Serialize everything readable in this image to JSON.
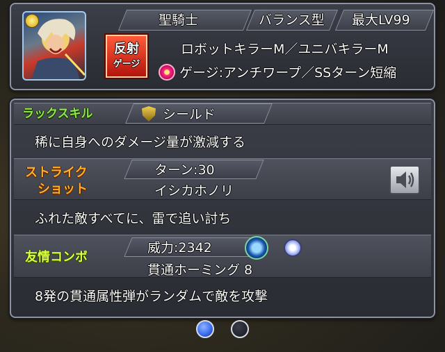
{
  "header": {
    "tribe": "聖騎士",
    "type": "バランス型",
    "max_level": "最大LV99",
    "killer": "ロボットキラーM／ユニバキラーM",
    "gauge": "ゲージ:アンチワープ／SSターン短縮",
    "badge_line1": "反射",
    "badge_line2": "ゲージ"
  },
  "luck_skill": {
    "label": "ラックスキル",
    "name": "シールド",
    "description": "稀に自身へのダメージ量が激減する"
  },
  "strike_shot": {
    "label_line1": "ストライク",
    "label_line2": "ショット",
    "turns": "ターン:30",
    "name": "イシカホノリ",
    "description": "ふれた敵すべてに、雷で追い討ち"
  },
  "friend_combo": {
    "label": "友情コンボ",
    "power": "威力:2342",
    "name": "貫通ホーミング 8",
    "description": "8発の貫通属性弾がランダムで敵を攻撃"
  },
  "pagination": {
    "pages": 2,
    "current": 1
  },
  "colors": {
    "luck": "#8fe84a",
    "strike": "#ffb02a",
    "friend": "#d8ff42",
    "page_active": "#3b6ff0"
  }
}
